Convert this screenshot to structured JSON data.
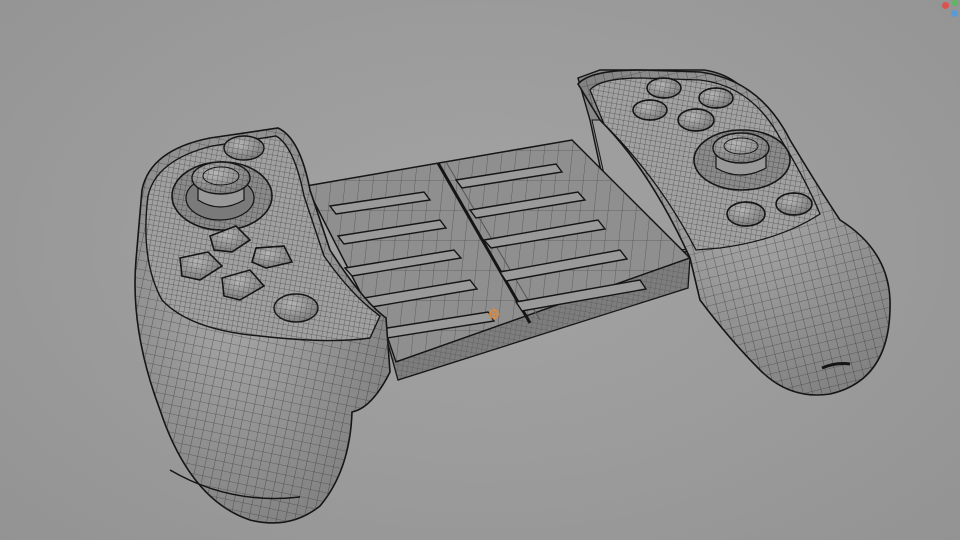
{
  "viewport": {
    "mode": "wireframe-overlay",
    "object": "gamepad-model",
    "colors": {
      "background": "#9b9b9b",
      "surface": "#8d8d8d",
      "surface_light": "#a6a6a6",
      "wire": "#2e2e2e",
      "edge": "#151515",
      "origin": "#e08a3a",
      "gizmo_x": "#d9534f",
      "gizmo_y": "#5cb85c",
      "gizmo_z": "#5b9bd5"
    }
  }
}
